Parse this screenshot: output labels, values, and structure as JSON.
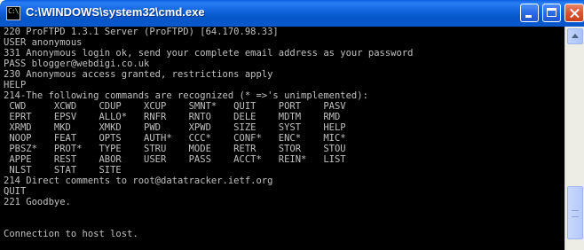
{
  "window": {
    "title": "C:\\WINDOWS\\system32\\cmd.exe",
    "icon_text": "C:\\"
  },
  "console": {
    "lines": [
      "220 ProFTPD 1.3.1 Server (ProFTPD) [64.170.98.33]",
      "USER anonymous",
      "331 Anonymous login ok, send your complete email address as your password",
      "PASS blogger@webdigi.co.uk",
      "230 Anonymous access granted, restrictions apply",
      "HELP",
      "214-The following commands are recognized (* =>'s unimplemented):",
      " CWD     XCWD    CDUP    XCUP    SMNT*   QUIT    PORT    PASV",
      " EPRT    EPSV    ALLO*   RNFR    RNTO    DELE    MDTM    RMD",
      " XRMD    MKD     XMKD    PWD     XPWD    SIZE    SYST    HELP",
      " NOOP    FEAT    OPTS    AUTH*   CCC*    CONF*   ENC*    MIC*",
      " PBSZ*   PROT*   TYPE    STRU    MODE    RETR    STOR    STOU",
      " APPE    REST    ABOR    USER    PASS    ACCT*   REIN*   LIST",
      " NLST    STAT    SITE",
      "214 Direct comments to root@datatracker.ietf.org",
      "QUIT",
      "221 Goodbye.",
      "",
      "",
      "Connection to host lost."
    ]
  },
  "colors": {
    "console_bg": "#000000",
    "console_fg": "#c0c0c0",
    "titlebar": "#0a58cf"
  },
  "icons": [
    "cmd-app-icon",
    "minimize-icon",
    "maximize-icon",
    "close-icon",
    "scroll-up-arrow-icon"
  ]
}
